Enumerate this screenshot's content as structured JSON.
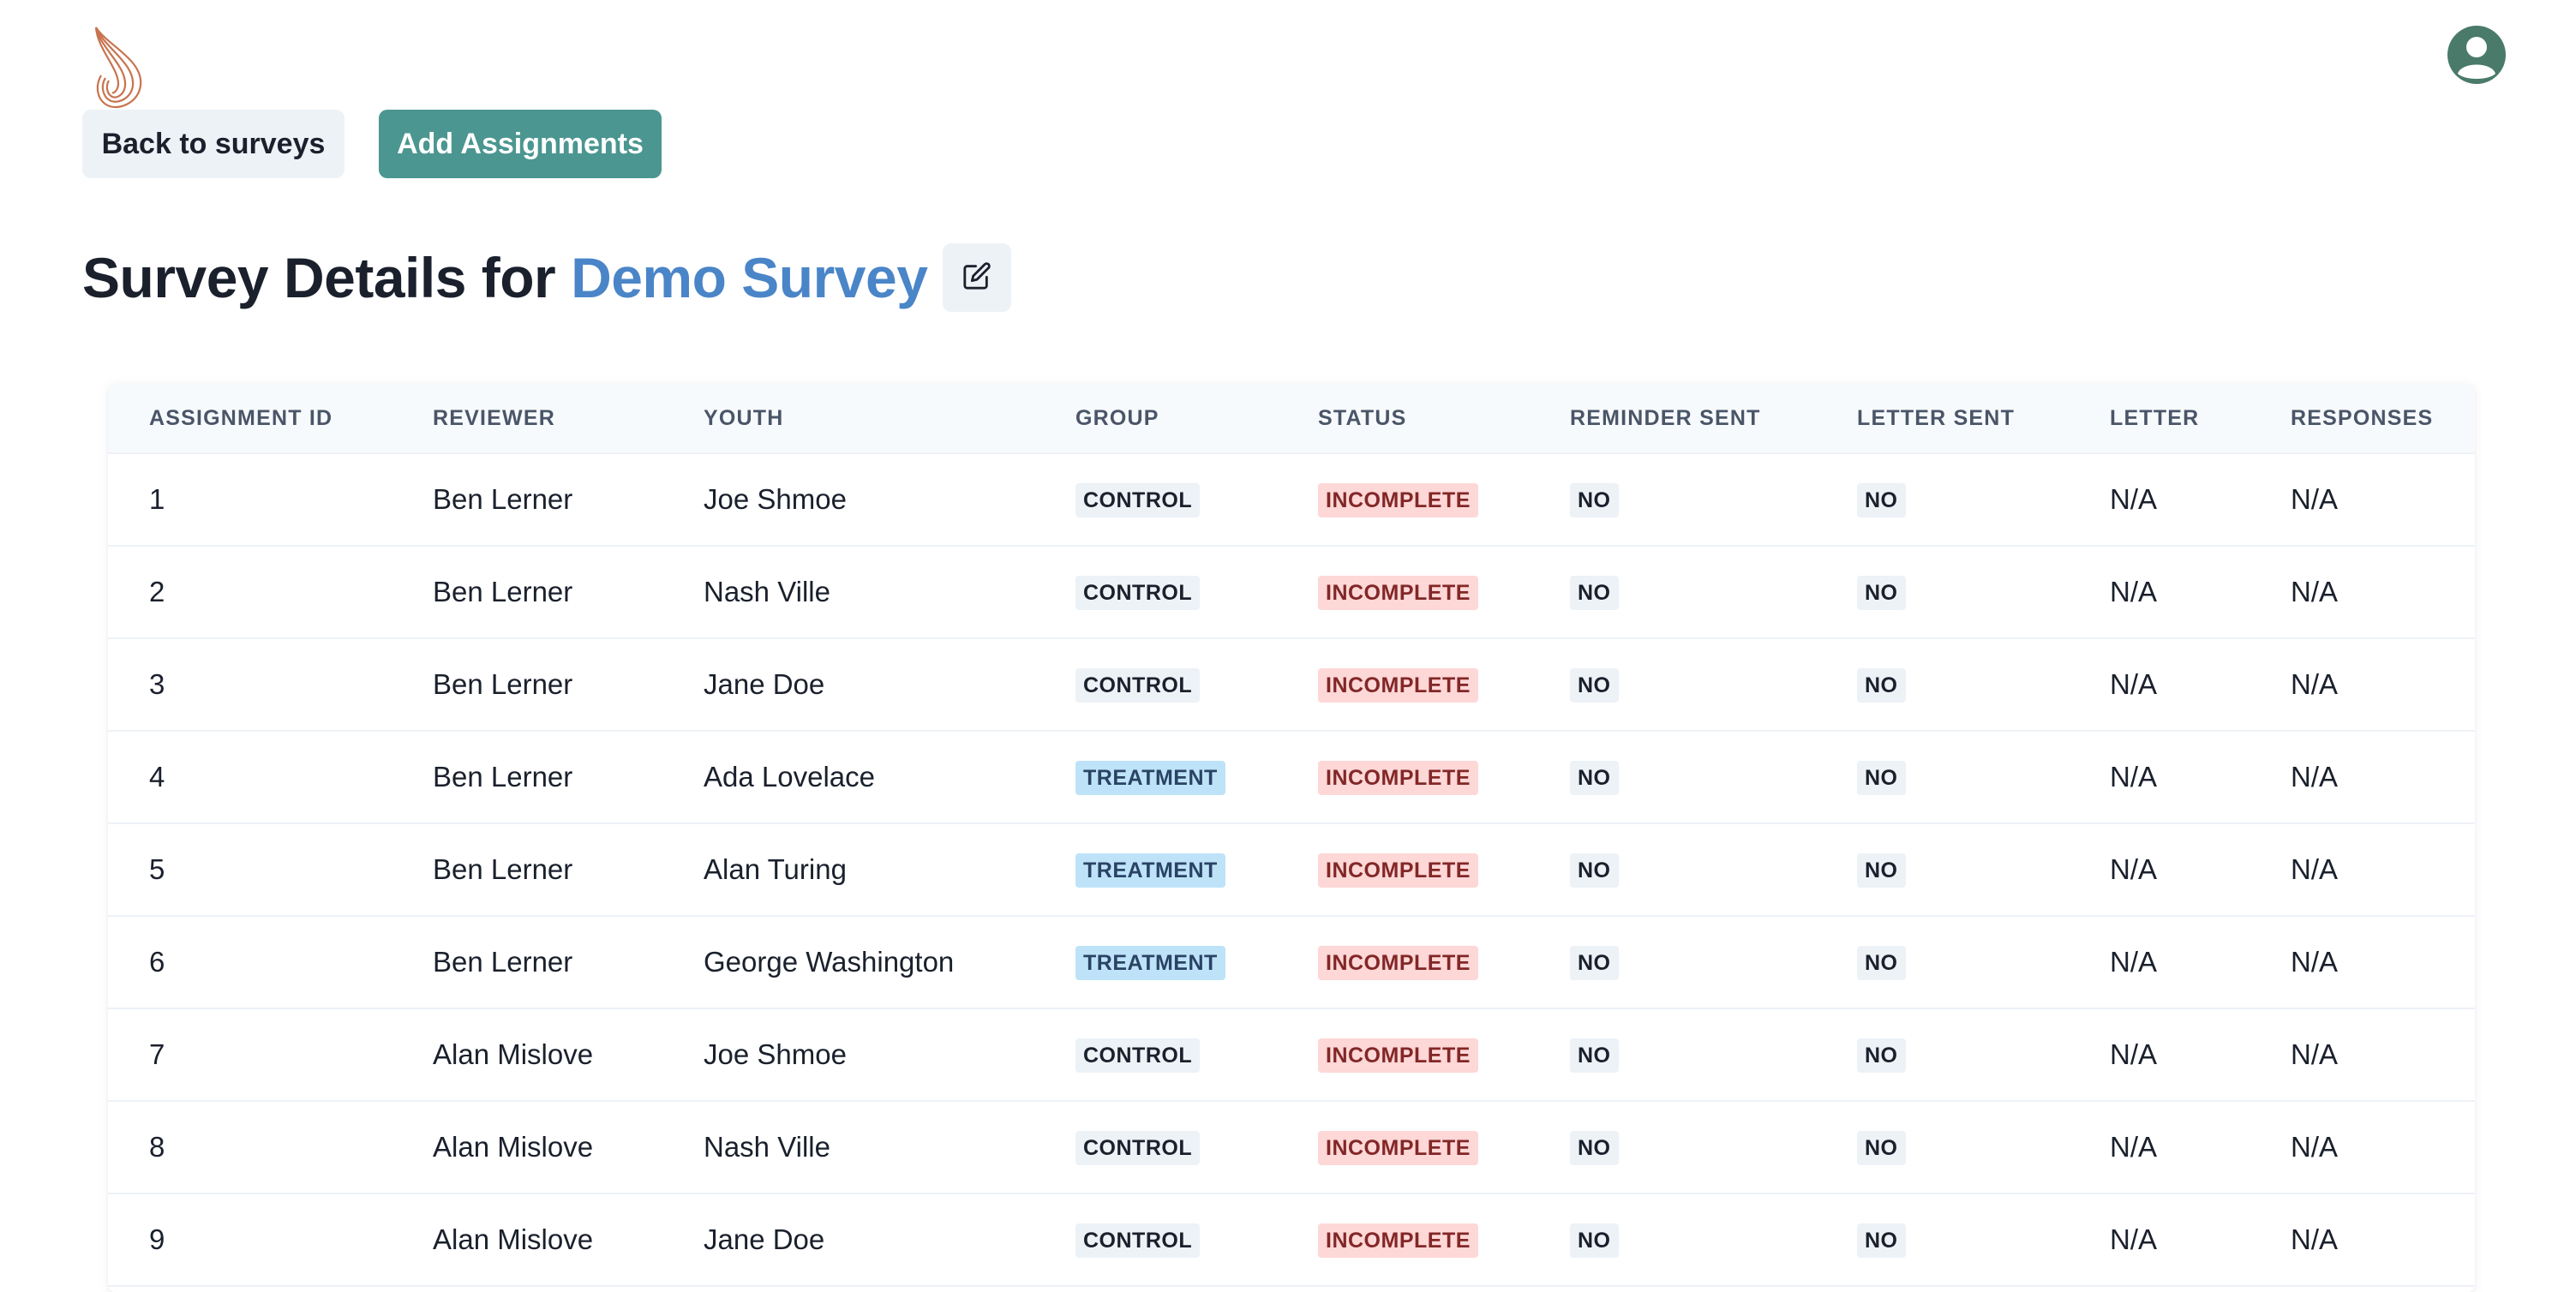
{
  "app": {
    "logo_icon": "flame-swirl-logo",
    "avatar_icon": "user-avatar-icon"
  },
  "toolbar": {
    "back_label": "Back to surveys",
    "add_label": "Add Assignments"
  },
  "heading": {
    "prefix": "Survey Details for ",
    "survey_name": "Demo Survey",
    "edit_icon": "edit-pencil-icon"
  },
  "colors": {
    "accent": "#4b9691",
    "survey_name": "#4a85c8",
    "incomplete_bg": "#fed7d7",
    "treatment_bg": "#bee3f8"
  },
  "table": {
    "headers": [
      "ASSIGNMENT ID",
      "REVIEWER",
      "YOUTH",
      "GROUP",
      "STATUS",
      "REMINDER SENT",
      "LETTER SENT",
      "LETTER",
      "RESPONSES"
    ],
    "rows": [
      {
        "id": "1",
        "reviewer": "Ben Lerner",
        "youth": "Joe Shmoe",
        "group": "CONTROL",
        "status": "INCOMPLETE",
        "reminder": "NO",
        "letter_sent": "NO",
        "letter": "N/A",
        "responses": "N/A"
      },
      {
        "id": "2",
        "reviewer": "Ben Lerner",
        "youth": "Nash Ville",
        "group": "CONTROL",
        "status": "INCOMPLETE",
        "reminder": "NO",
        "letter_sent": "NO",
        "letter": "N/A",
        "responses": "N/A"
      },
      {
        "id": "3",
        "reviewer": "Ben Lerner",
        "youth": "Jane Doe",
        "group": "CONTROL",
        "status": "INCOMPLETE",
        "reminder": "NO",
        "letter_sent": "NO",
        "letter": "N/A",
        "responses": "N/A"
      },
      {
        "id": "4",
        "reviewer": "Ben Lerner",
        "youth": "Ada Lovelace",
        "group": "TREATMENT",
        "status": "INCOMPLETE",
        "reminder": "NO",
        "letter_sent": "NO",
        "letter": "N/A",
        "responses": "N/A"
      },
      {
        "id": "5",
        "reviewer": "Ben Lerner",
        "youth": "Alan Turing",
        "group": "TREATMENT",
        "status": "INCOMPLETE",
        "reminder": "NO",
        "letter_sent": "NO",
        "letter": "N/A",
        "responses": "N/A"
      },
      {
        "id": "6",
        "reviewer": "Ben Lerner",
        "youth": "George Washington",
        "group": "TREATMENT",
        "status": "INCOMPLETE",
        "reminder": "NO",
        "letter_sent": "NO",
        "letter": "N/A",
        "responses": "N/A"
      },
      {
        "id": "7",
        "reviewer": "Alan Mislove",
        "youth": "Joe Shmoe",
        "group": "CONTROL",
        "status": "INCOMPLETE",
        "reminder": "NO",
        "letter_sent": "NO",
        "letter": "N/A",
        "responses": "N/A"
      },
      {
        "id": "8",
        "reviewer": "Alan Mislove",
        "youth": "Nash Ville",
        "group": "CONTROL",
        "status": "INCOMPLETE",
        "reminder": "NO",
        "letter_sent": "NO",
        "letter": "N/A",
        "responses": "N/A"
      },
      {
        "id": "9",
        "reviewer": "Alan Mislove",
        "youth": "Jane Doe",
        "group": "CONTROL",
        "status": "INCOMPLETE",
        "reminder": "NO",
        "letter_sent": "NO",
        "letter": "N/A",
        "responses": "N/A"
      }
    ]
  }
}
